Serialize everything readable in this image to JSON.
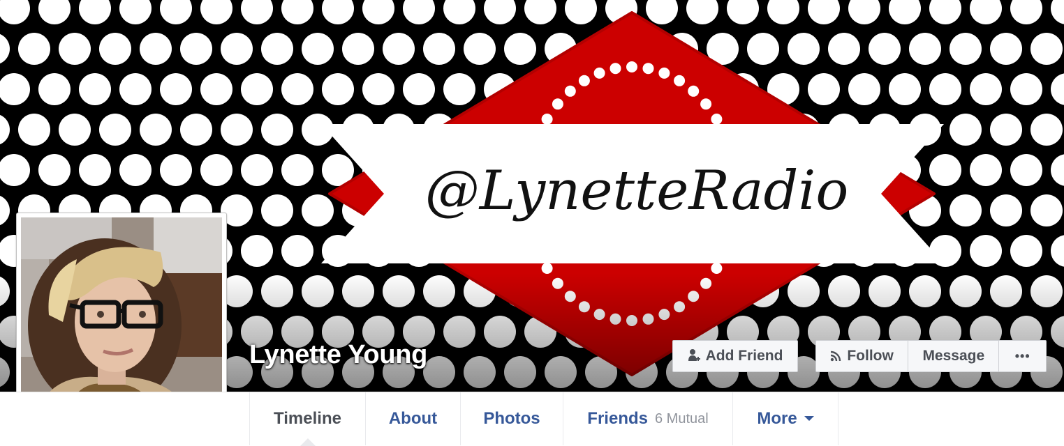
{
  "profile": {
    "name": "Lynette Young"
  },
  "cover": {
    "handle_text": "@LynetteRadio",
    "colors": {
      "background": "#000000",
      "dots": "#ffffff",
      "diamond": "#cc0000",
      "banner": "#ffffff",
      "script": "#111111"
    }
  },
  "actions": {
    "add_friend_label": "Add Friend",
    "follow_label": "Follow",
    "message_label": "Message",
    "more_label": "•••"
  },
  "nav": {
    "tabs": [
      {
        "label": "Timeline",
        "active": true
      },
      {
        "label": "About"
      },
      {
        "label": "Photos"
      },
      {
        "label": "Friends",
        "sub": "6 Mutual"
      },
      {
        "label": "More"
      }
    ]
  },
  "icons": {
    "add_friend": "add-friend-icon",
    "follow": "rss-follow-icon",
    "more_caret": "chevron-down-icon"
  },
  "colors": {
    "link": "#365899",
    "button_bg": "#f6f7f9",
    "button_border": "#ced0d4",
    "button_text": "#4b4f56"
  }
}
